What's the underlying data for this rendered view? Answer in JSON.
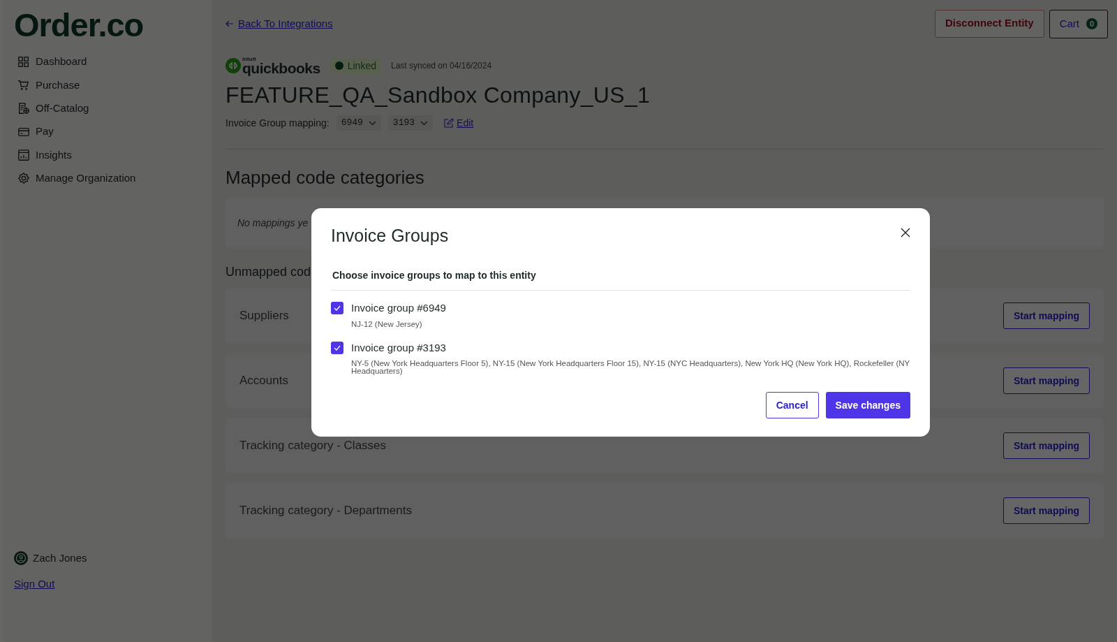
{
  "sidebar": {
    "logo": "Order.co",
    "items": [
      {
        "label": "Dashboard",
        "kind": "grid"
      },
      {
        "label": "Purchase",
        "kind": "cart"
      },
      {
        "label": "Off-Catalog",
        "kind": "document"
      },
      {
        "label": "Pay",
        "kind": "card"
      },
      {
        "label": "Insights",
        "kind": "chart"
      },
      {
        "label": "Manage Organization",
        "kind": "gear"
      }
    ],
    "user": "Zach Jones",
    "sign_out": "Sign Out"
  },
  "header": {
    "back_link": "Back To Integrations",
    "disconnect": "Disconnect Entity",
    "cart": "Cart",
    "cart_count": "0"
  },
  "entity": {
    "logo_brand": "intuit",
    "logo_name": "quickbooks",
    "status": {
      "label": "Linked",
      "linked": true
    },
    "last_synced": "Last synced on 04/16/2024",
    "title": "FEATURE_QA_Sandbox Company_US_1",
    "mapping_label": "Invoice Group mapping:",
    "mapping_chips": [
      "6949",
      "3193"
    ],
    "edit": "Edit"
  },
  "mapped": {
    "title": "Mapped code categories",
    "empty": "No mappings ye"
  },
  "unmapped": {
    "title": "Unmapped cod",
    "rows": [
      {
        "label": "Suppliers",
        "action": "Start mapping"
      },
      {
        "label": "Accounts",
        "action": "Start mapping"
      },
      {
        "label": "Tracking category - Classes",
        "action": "Start mapping"
      },
      {
        "label": "Tracking category - Departments",
        "action": "Start mapping"
      }
    ]
  },
  "modal": {
    "title": "Invoice Groups",
    "subtitle": "Choose invoice groups to map to this entity",
    "groups": [
      {
        "label": "Invoice group #6949",
        "detail": "NJ-12 (New Jersey)",
        "checked": true
      },
      {
        "label": "Invoice group #3193",
        "detail": "NY-5 (New York Headquarters Floor 5), NY-15 (New York Headquarters Floor 15), NY-15 (NYC Headquarters), New York HQ (New York HQ), Rockefeller (NY Headquarters)",
        "checked": true
      }
    ],
    "cancel": "Cancel",
    "save": "Save changes"
  }
}
